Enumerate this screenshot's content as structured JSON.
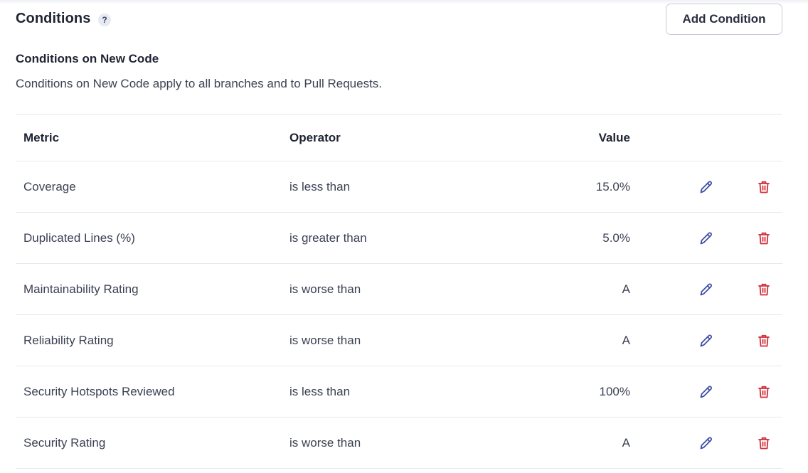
{
  "header": {
    "title": "Conditions",
    "help_label": "?",
    "add_button_label": "Add Condition"
  },
  "section": {
    "title": "Conditions on New Code",
    "description": "Conditions on New Code apply to all branches and to Pull Requests."
  },
  "table": {
    "columns": [
      "Metric",
      "Operator",
      "Value"
    ],
    "rows": [
      {
        "metric": "Coverage",
        "operator": "is less than",
        "value": "15.0%"
      },
      {
        "metric": "Duplicated Lines (%)",
        "operator": "is greater than",
        "value": "5.0%"
      },
      {
        "metric": "Maintainability Rating",
        "operator": "is worse than",
        "value": "A"
      },
      {
        "metric": "Reliability Rating",
        "operator": "is worse than",
        "value": "A"
      },
      {
        "metric": "Security Hotspots Reviewed",
        "operator": "is less than",
        "value": "100%"
      },
      {
        "metric": "Security Rating",
        "operator": "is worse than",
        "value": "A"
      }
    ]
  },
  "icons": {
    "edit": "pencil-icon",
    "delete": "trash-icon"
  },
  "colors": {
    "edit_icon": "#3f4fa6",
    "delete_icon": "#d02f3a"
  }
}
